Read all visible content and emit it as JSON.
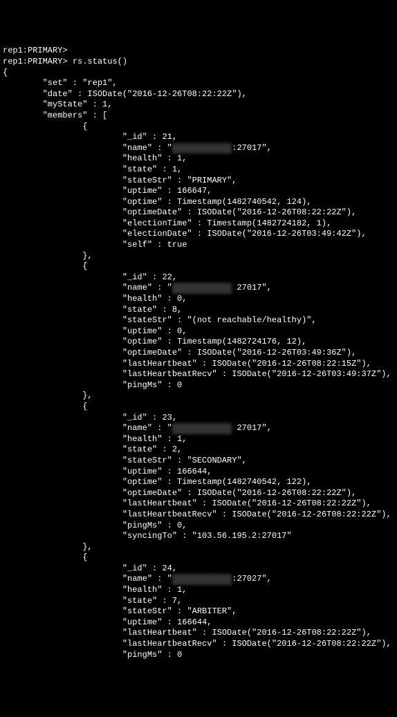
{
  "prompt1": "rep1:PRIMARY>",
  "prompt2": "rep1:PRIMARY> ",
  "command": "rs.status()",
  "open_brace": "{",
  "set_line": "        \"set\" : \"rep1\",",
  "date_line": "        \"date\" : ISODate(\"2016-12-26T08:22:22Z\"),",
  "mystate_line": "        \"myState\" : 1,",
  "members_open": "        \"members\" : [",
  "obj_open": "                {",
  "obj_close": "                },",
  "m1_id": "                        \"_id\" : 21,",
  "m1_name_prefix": "                        \"name\" : \"",
  "m1_name_redacted": "xxx xx xxx x",
  "m1_name_suffix": ":27017\",",
  "m1_health": "                        \"health\" : 1,",
  "m1_state": "                        \"state\" : 1,",
  "m1_stateStr": "                        \"stateStr\" : \"PRIMARY\",",
  "m1_uptime": "                        \"uptime\" : 166647,",
  "m1_optime": "                        \"optime\" : Timestamp(1482740542, 124),",
  "m1_optimeDate": "                        \"optimeDate\" : ISODate(\"2016-12-26T08:22:22Z\"),",
  "m1_electionTime": "                        \"electionTime\" : Timestamp(1482724182, 1),",
  "m1_electionDate": "                        \"electionDate\" : ISODate(\"2016-12-26T03:49:42Z\"),",
  "m1_self": "                        \"self\" : true",
  "m2_id": "                        \"_id\" : 22,",
  "m2_name_prefix": "                        \"name\" : \"",
  "m2_name_redacted": "xxx xx xxx x",
  "m2_name_space": " ",
  "m2_name_suffix": "27017\",",
  "m2_health": "                        \"health\" : 0,",
  "m2_state": "                        \"state\" : 8,",
  "m2_stateStr": "                        \"stateStr\" : \"(not reachable/healthy)\",",
  "m2_uptime": "                        \"uptime\" : 0,",
  "m2_optime": "                        \"optime\" : Timestamp(1482724176, 12),",
  "m2_optimeDate": "                        \"optimeDate\" : ISODate(\"2016-12-26T03:49:36Z\"),",
  "m2_lastHeartbeat": "                        \"lastHeartbeat\" : ISODate(\"2016-12-26T08:22:15Z\"),",
  "m2_lastHeartbeatRecv": "                        \"lastHeartbeatRecv\" : ISODate(\"2016-12-26T03:49:37Z\"),",
  "m2_pingMs": "                        \"pingMs\" : 0",
  "m3_id": "                        \"_id\" : 23,",
  "m3_name_prefix": "                        \"name\" : \"",
  "m3_name_redacted": "xxx xx xxx x",
  "m3_name_space": " ",
  "m3_name_suffix": "27017\",",
  "m3_health": "                        \"health\" : 1,",
  "m3_state": "                        \"state\" : 2,",
  "m3_stateStr": "                        \"stateStr\" : \"SECONDARY\",",
  "m3_uptime": "                        \"uptime\" : 166644,",
  "m3_optime": "                        \"optime\" : Timestamp(1482740542, 122),",
  "m3_optimeDate": "                        \"optimeDate\" : ISODate(\"2016-12-26T08:22:22Z\"),",
  "m3_lastHeartbeat": "                        \"lastHeartbeat\" : ISODate(\"2016-12-26T08:22:22Z\"),",
  "m3_lastHeartbeatRecv": "                        \"lastHeartbeatRecv\" : ISODate(\"2016-12-26T08:22:22Z\"),",
  "m3_pingMs": "                        \"pingMs\" : 0,",
  "m3_syncingTo": "                        \"syncingTo\" : \"103.56.195.2:27017\"",
  "m4_id": "                        \"_id\" : 24,",
  "m4_name_prefix": "                        \"name\" : \"",
  "m4_name_redacted": "xxx xx xxx x",
  "m4_name_suffix": ":27027\",",
  "m4_health": "                        \"health\" : 1,",
  "m4_state": "                        \"state\" : 7,",
  "m4_stateStr": "                        \"stateStr\" : \"ARBITER\",",
  "m4_uptime": "                        \"uptime\" : 166644,",
  "m4_lastHeartbeat": "                        \"lastHeartbeat\" : ISODate(\"2016-12-26T08:22:22Z\"),",
  "m4_lastHeartbeatRecv": "                        \"lastHeartbeatRecv\" : ISODate(\"2016-12-26T08:22:22Z\"),",
  "m4_pingMs": "                        \"pingMs\" : 0"
}
